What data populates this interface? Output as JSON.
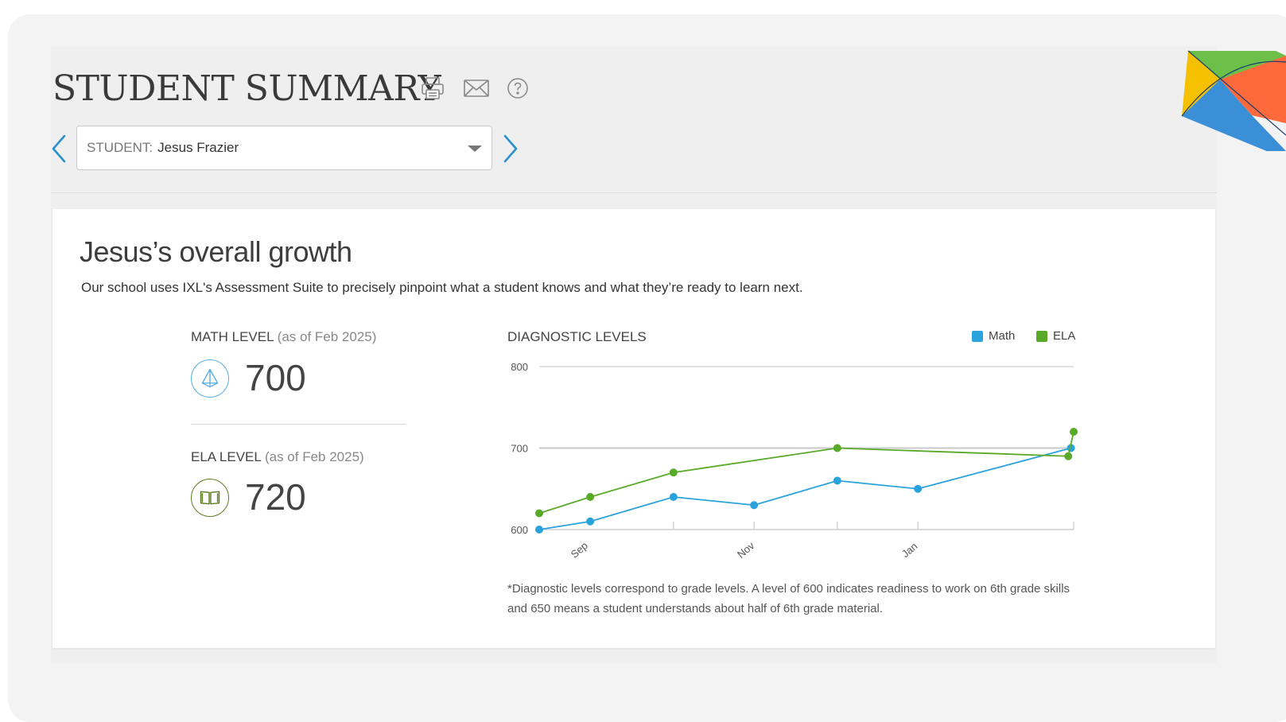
{
  "header": {
    "title": "STUDENT SUMMARY",
    "print_icon": "printer-icon",
    "email_icon": "envelope-icon",
    "help_icon": "help-circle-icon"
  },
  "student_selector": {
    "label": "STUDENT:",
    "value": "Jesus Frazier",
    "prev_icon": "chevron-left-icon",
    "next_icon": "chevron-right-icon"
  },
  "growth": {
    "title": "Jesus’s overall growth",
    "description": "Our school uses IXL's Assessment Suite to precisely pinpoint what a student knows and what they’re ready to learn next."
  },
  "levels": [
    {
      "label": "MATH LEVEL",
      "sublabel": "(as of Feb 2025)",
      "value": "700",
      "icon": "pyramid-icon",
      "color": "#5aaedc"
    },
    {
      "label": "ELA LEVEL",
      "sublabel": "(as of Feb 2025)",
      "value": "720",
      "icon": "book-icon",
      "color": "#5c7a1f"
    }
  ],
  "chart_title": "DIAGNOSTIC LEVELS",
  "chart_data": {
    "type": "line",
    "xlim": [
      "2024-08-01",
      "2025-02-16"
    ],
    "ylim": [
      600,
      800
    ],
    "yticks": [
      600,
      700,
      800
    ],
    "xticks": [
      {
        "label": "Sep",
        "date": "2024-08-16"
      },
      {
        "label": "Nov",
        "date": "2024-10-17"
      },
      {
        "label": "Jan",
        "date": "2024-12-17"
      }
    ],
    "grid": true,
    "legend": "top-right",
    "series": [
      {
        "name": "Math",
        "color": "#2aa2dc",
        "points": [
          {
            "date": "2024-08-01",
            "value": 600
          },
          {
            "date": "2024-08-20",
            "value": 610
          },
          {
            "date": "2024-09-20",
            "value": 640
          },
          {
            "date": "2024-10-20",
            "value": 630
          },
          {
            "date": "2024-11-20",
            "value": 660
          },
          {
            "date": "2024-12-20",
            "value": 650
          },
          {
            "date": "2025-02-15",
            "value": 700
          }
        ]
      },
      {
        "name": "ELA",
        "color": "#5aaa2a",
        "points": [
          {
            "date": "2024-08-01",
            "value": 620
          },
          {
            "date": "2024-08-20",
            "value": 640
          },
          {
            "date": "2024-09-20",
            "value": 670
          },
          {
            "date": "2024-11-20",
            "value": 700
          },
          {
            "date": "2025-02-14",
            "value": 690
          },
          {
            "date": "2025-02-16",
            "value": 720
          }
        ]
      }
    ]
  },
  "footnote": "*Diagnostic levels correspond to grade levels. A level of 600 indicates readiness to work on 6th grade skills and 650 means a student understands about half of 6th grade material.",
  "decor": {
    "logo": "ixl-kite-logo"
  }
}
